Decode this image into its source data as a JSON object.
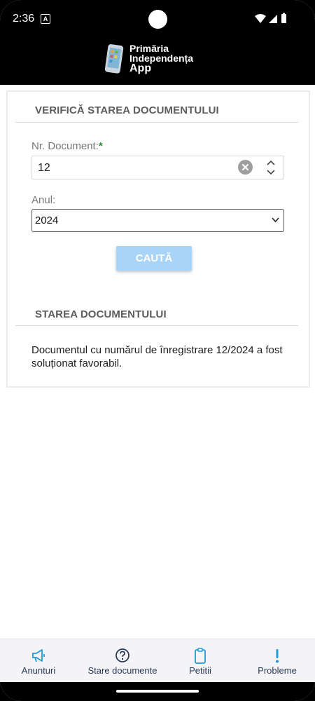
{
  "status": {
    "time": "2:36"
  },
  "app": {
    "logo_line1": "Primăria",
    "logo_line2": "Independența",
    "logo_line3": "App"
  },
  "verify": {
    "title": "VERIFICĂ STAREA DOCUMENTULUI",
    "doc_label": "Nr. Document:",
    "doc_required": "*",
    "doc_value": "12",
    "year_label": "Anul:",
    "year_value": "2024",
    "search_label": "CAUTĂ"
  },
  "state": {
    "title": "STAREA DOCUMENTULUI",
    "message": "Documentul cu numărul de înregistrare 12/2024 a fost soluționat favorabil."
  },
  "nav": {
    "items": [
      {
        "label": "Anunturi",
        "icon": "megaphone-icon"
      },
      {
        "label": "Stare documente",
        "icon": "question-circle-icon"
      },
      {
        "label": "Petitii",
        "icon": "clipboard-icon"
      },
      {
        "label": "Probleme",
        "icon": "exclamation-icon"
      }
    ],
    "accent": "#1e9bd7"
  }
}
